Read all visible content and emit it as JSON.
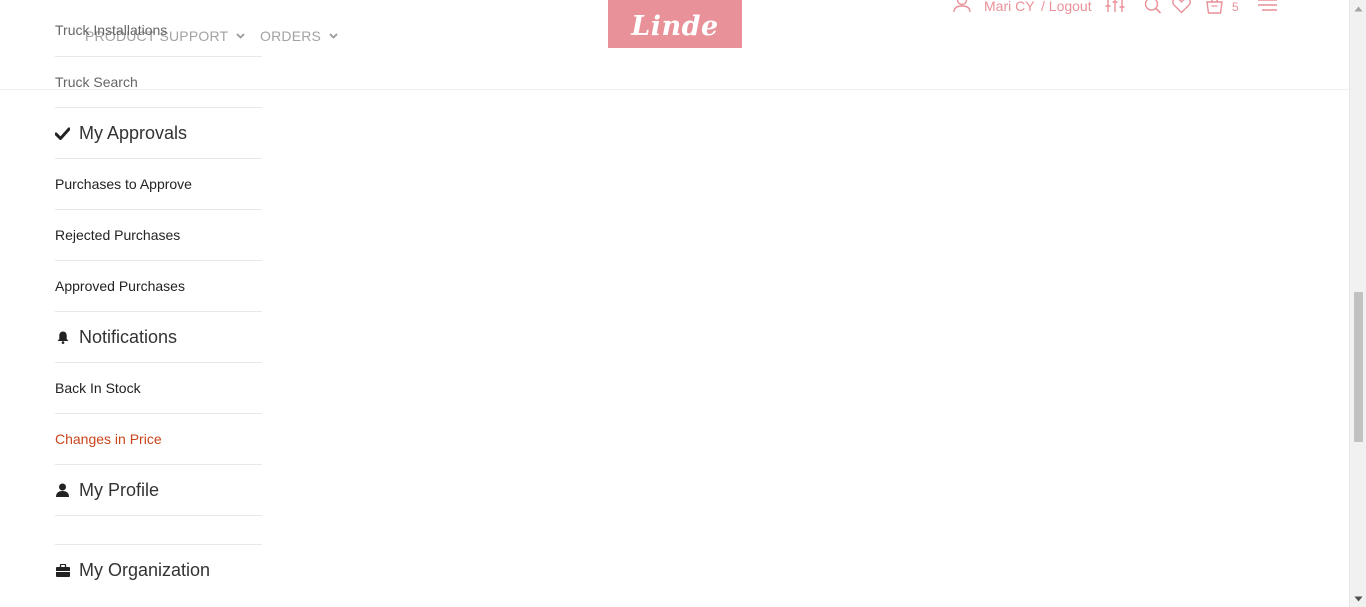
{
  "header": {
    "nav": [
      {
        "label": "PRODUCT SUPPORT"
      },
      {
        "label": "ORDERS"
      }
    ],
    "logo_text": "Linde",
    "user_name": "Mari CY",
    "logout_label": "/ Logout",
    "cart_count": "5",
    "icons": [
      "user-icon",
      "filter-icon",
      "search-icon",
      "heart-icon",
      "cart-icon",
      "menu-icon"
    ],
    "accent_color": "#e99198"
  },
  "sidebar": {
    "truck_links": [
      {
        "label": "Truck Installations"
      },
      {
        "label": "Truck Search"
      }
    ],
    "approvals": {
      "heading": "My Approvals",
      "items": [
        {
          "label": "Purchases to Approve"
        },
        {
          "label": "Rejected Purchases"
        },
        {
          "label": "Approved Purchases"
        }
      ]
    },
    "notifications": {
      "heading": "Notifications",
      "items": [
        {
          "label": "Back In Stock"
        },
        {
          "label": "Changes in Price"
        }
      ]
    },
    "profile": {
      "heading": "My Profile"
    },
    "organization": {
      "heading": "My Organization"
    },
    "active_color": "#c8441c"
  }
}
